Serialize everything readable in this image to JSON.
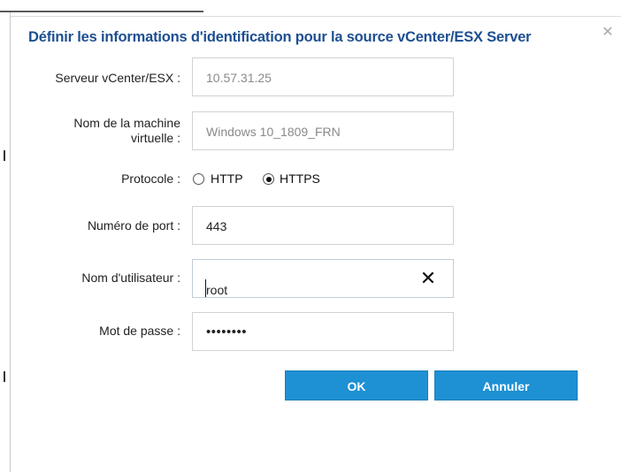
{
  "dialog": {
    "title": "Définir les informations d'identification pour la source vCenter/ESX Server",
    "close_icon": "close-icon"
  },
  "fields": {
    "server_label": "Serveur vCenter/ESX :",
    "server_value": "10.57.31.25",
    "vm_label_line1": "Nom de la machine",
    "vm_label_line2": "virtuelle :",
    "vm_value": "Windows 10_1809_FRN",
    "protocol_label": "Protocole :",
    "protocol_options": [
      "HTTP",
      "HTTPS"
    ],
    "protocol_selected": "HTTPS",
    "port_label": "Numéro de port :",
    "port_value": "443",
    "user_label": "Nom d'utilisateur :",
    "user_value": "root",
    "password_label": "Mot de passe :",
    "password_value": "••••••••"
  },
  "buttons": {
    "ok_label": "OK",
    "cancel_label": "Annuler"
  },
  "colors": {
    "title": "#1d4f91",
    "button": "#1e90d4"
  }
}
